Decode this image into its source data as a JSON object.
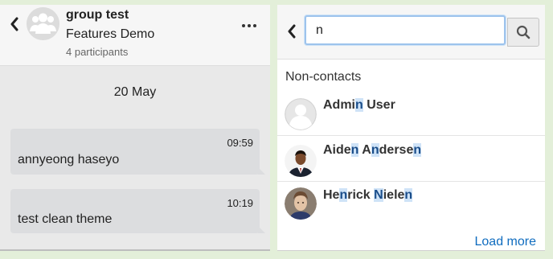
{
  "conversation": {
    "group_name": "group test",
    "course_name": "Features Demo",
    "participants_text": "4 participants",
    "date_separator": "20 May",
    "messages": [
      {
        "time": "09:59",
        "text": "annyeong haseyo"
      },
      {
        "time": "10:19",
        "text": "test clean theme"
      }
    ]
  },
  "search": {
    "value": "n",
    "placeholder": "",
    "section_title": "Non-contacts",
    "results": [
      {
        "parts": [
          "Admi",
          "n",
          " User"
        ],
        "avatar": "default-user-avatar-icon"
      },
      {
        "parts": [
          "Aide",
          "n",
          " A",
          "n",
          "derse",
          "n"
        ],
        "avatar": "user-photo"
      },
      {
        "parts": [
          "He",
          "n",
          "rick ",
          "N",
          "iele",
          "n"
        ],
        "avatar": "user-photo"
      }
    ],
    "load_more_label": "Load more"
  },
  "colors": {
    "page_background": "#e3efd9",
    "chat_background": "#e9e9e9",
    "bubble": "#dcdddf",
    "match_highlight": "#cfe3f7",
    "link": "#0f6cbf",
    "input_focus_border": "#9dc3ec"
  },
  "icons": {
    "back": "chevron-left-icon",
    "more": "more-horizontal-icon",
    "search": "search-icon",
    "group": "group-avatar-icon"
  }
}
